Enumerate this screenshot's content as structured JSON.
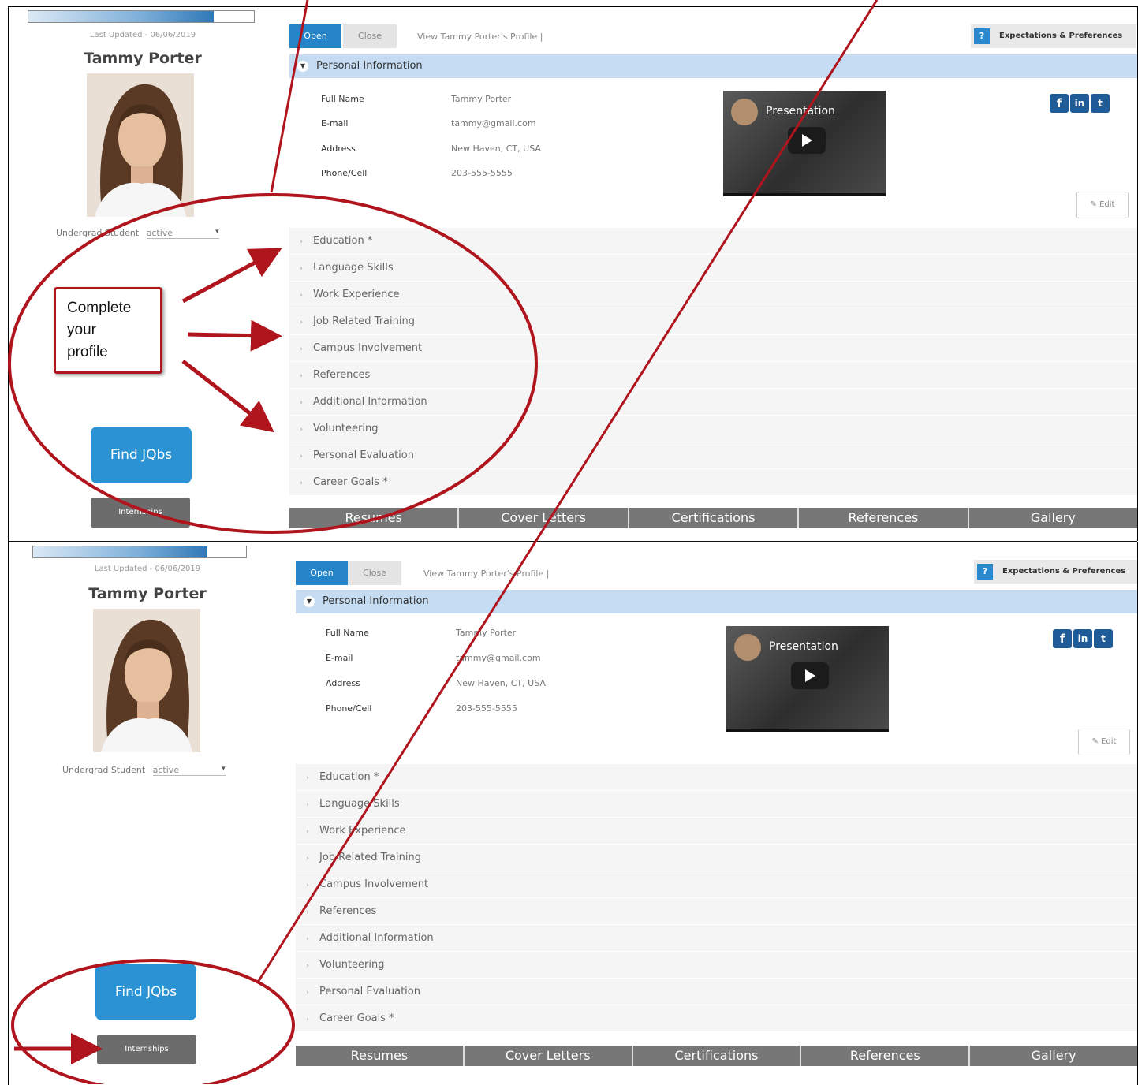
{
  "panels": [
    {
      "progress_fraction": 0.82,
      "last_updated": "Last Updated - 06/06/2019",
      "name": "Tammy Porter",
      "status_label": "Undergrad Student",
      "status_value": "active",
      "find_jobs": "Find JQbs",
      "internships": "Internships",
      "open": "Open",
      "close": "Close",
      "view_profile": "View Tammy Porter's Profile   |",
      "expectations": "Expectations & Preferences",
      "personal_info": "Personal Information",
      "fields": [
        {
          "label": "Full Name",
          "value": "Tammy Porter"
        },
        {
          "label": "E-mail",
          "value": "tammy@gmail.com"
        },
        {
          "label": "Address",
          "value": "New Haven, CT, USA"
        },
        {
          "label": "Phone/Cell",
          "value": "203-555-5555"
        }
      ],
      "video_title": "Presentation",
      "edit": "Edit",
      "sections": [
        "Education *",
        "Language Skills",
        "Work Experience",
        "Job Related Training",
        "Campus Involvement",
        "References",
        "Additional Information",
        "Volunteering",
        "Personal Evaluation",
        "Career Goals *"
      ],
      "tabs": [
        "Resumes",
        "Cover Letters",
        "Certifications",
        "References",
        "Gallery"
      ]
    },
    {
      "progress_fraction": 0.82,
      "last_updated": "Last Updated - 06/06/2019",
      "name": "Tammy Porter",
      "status_label": "Undergrad Student",
      "status_value": "active",
      "find_jobs": "Find JQbs",
      "internships": "Internships",
      "open": "Open",
      "close": "Close",
      "view_profile": "View Tammy Porter's Profile   |",
      "expectations": "Expectations & Preferences",
      "personal_info": "Personal Information",
      "fields": [
        {
          "label": "Full Name",
          "value": "Tammy Porter"
        },
        {
          "label": "E-mail",
          "value": "tammy@gmail.com"
        },
        {
          "label": "Address",
          "value": "New Haven, CT, USA"
        },
        {
          "label": "Phone/Cell",
          "value": "203-555-5555"
        }
      ],
      "video_title": "Presentation",
      "edit": "Edit",
      "sections": [
        "Education *",
        "Language Skills",
        "Work Experience",
        "Job Related Training",
        "Campus Involvement",
        "References",
        "Additional Information",
        "Volunteering",
        "Personal Evaluation",
        "Career Goals *"
      ],
      "tabs": [
        "Resumes",
        "Cover Letters",
        "Certifications",
        "References",
        "Gallery"
      ]
    }
  ],
  "callout": {
    "line1": "Complete",
    "line2": "your",
    "line3": "profile"
  },
  "social_icons": [
    "facebook-icon",
    "linkedin-icon",
    "twitter-icon"
  ],
  "colors": {
    "primary_blue": "#2583c8",
    "annotation_red": "#b0141d",
    "header_blue": "#c5dcf2",
    "tab_gray": "#777777"
  }
}
